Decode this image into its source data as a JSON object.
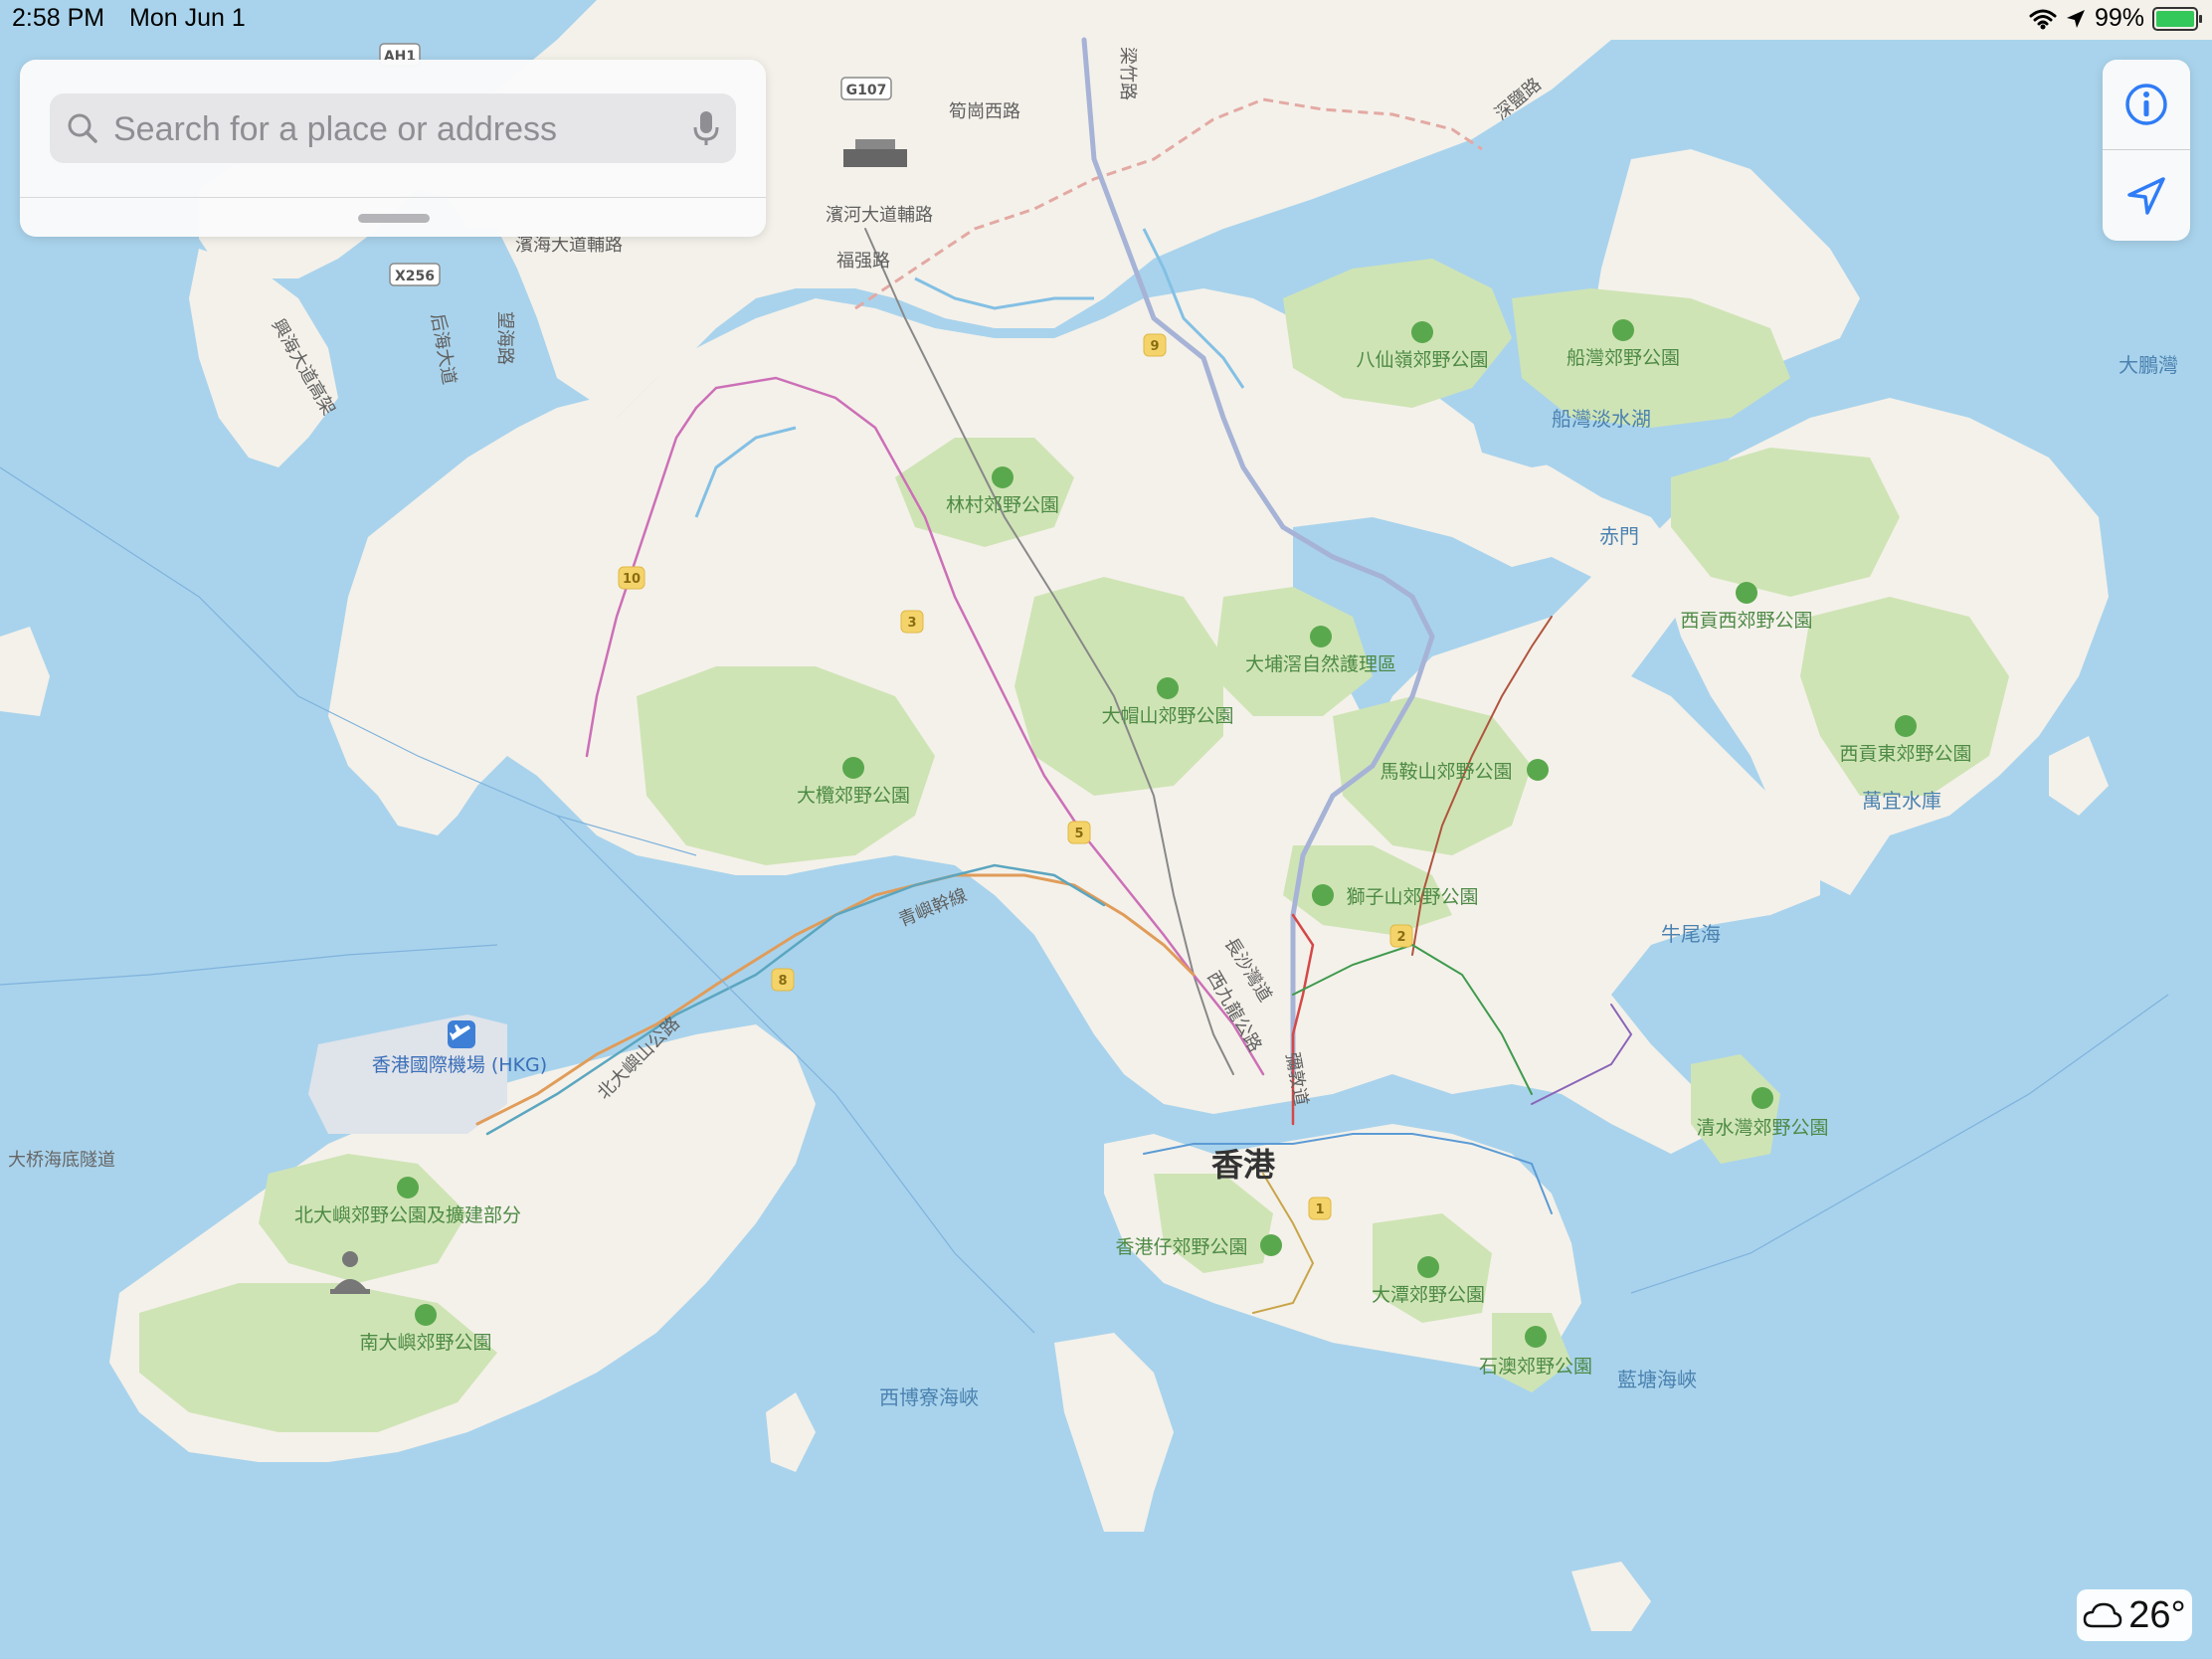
{
  "status_bar": {
    "time": "2:58 PM",
    "date": "Mon Jun 1",
    "battery": "99%",
    "battery_level": 0.99
  },
  "search": {
    "placeholder": "Search for a place or address"
  },
  "weather": {
    "icon": "cloud-icon",
    "temperature": "26°"
  },
  "map": {
    "city": "香港",
    "airport": "香港國際機場 (HKG)",
    "parks": [
      "八仙嶺郊野公園",
      "船灣郊野公園",
      "林村郊野公園",
      "大埔滘自然護理區",
      "大帽山郊野公園",
      "大欖郊野公園",
      "馬鞍山郊野公園",
      "獅子山郊野公園",
      "西貢西郊野公園",
      "西貢東郊野公園",
      "清水灣郊野公園",
      "香港仔郊野公園",
      "大潭郊野公園",
      "石澳郊野公園",
      "北大嶼郊野公園及擴建部分",
      "南大嶼郊野公園"
    ],
    "water": [
      "船灣淡水湖",
      "赤門",
      "大鵬灣",
      "萬宜水庫",
      "牛尾海",
      "西博寮海峽",
      "藍塘海峽"
    ],
    "roads": [
      "筍崗西路",
      "濱河大道輔路",
      "福强路",
      "濱海大道輔路",
      "深鹽路",
      "興海大道高架",
      "后海大道",
      "望海路",
      "梁竹路",
      "青嶼幹線",
      "北大嶼山公路",
      "長沙灣道",
      "彌敦道",
      "西九龍公路"
    ],
    "tunnels": [
      "大桥海底隧道"
    ],
    "highway_shields": [
      "AH1",
      "G107",
      "X256"
    ],
    "route_shields": [
      "9",
      "10",
      "3",
      "5",
      "8",
      "2",
      "1"
    ]
  }
}
